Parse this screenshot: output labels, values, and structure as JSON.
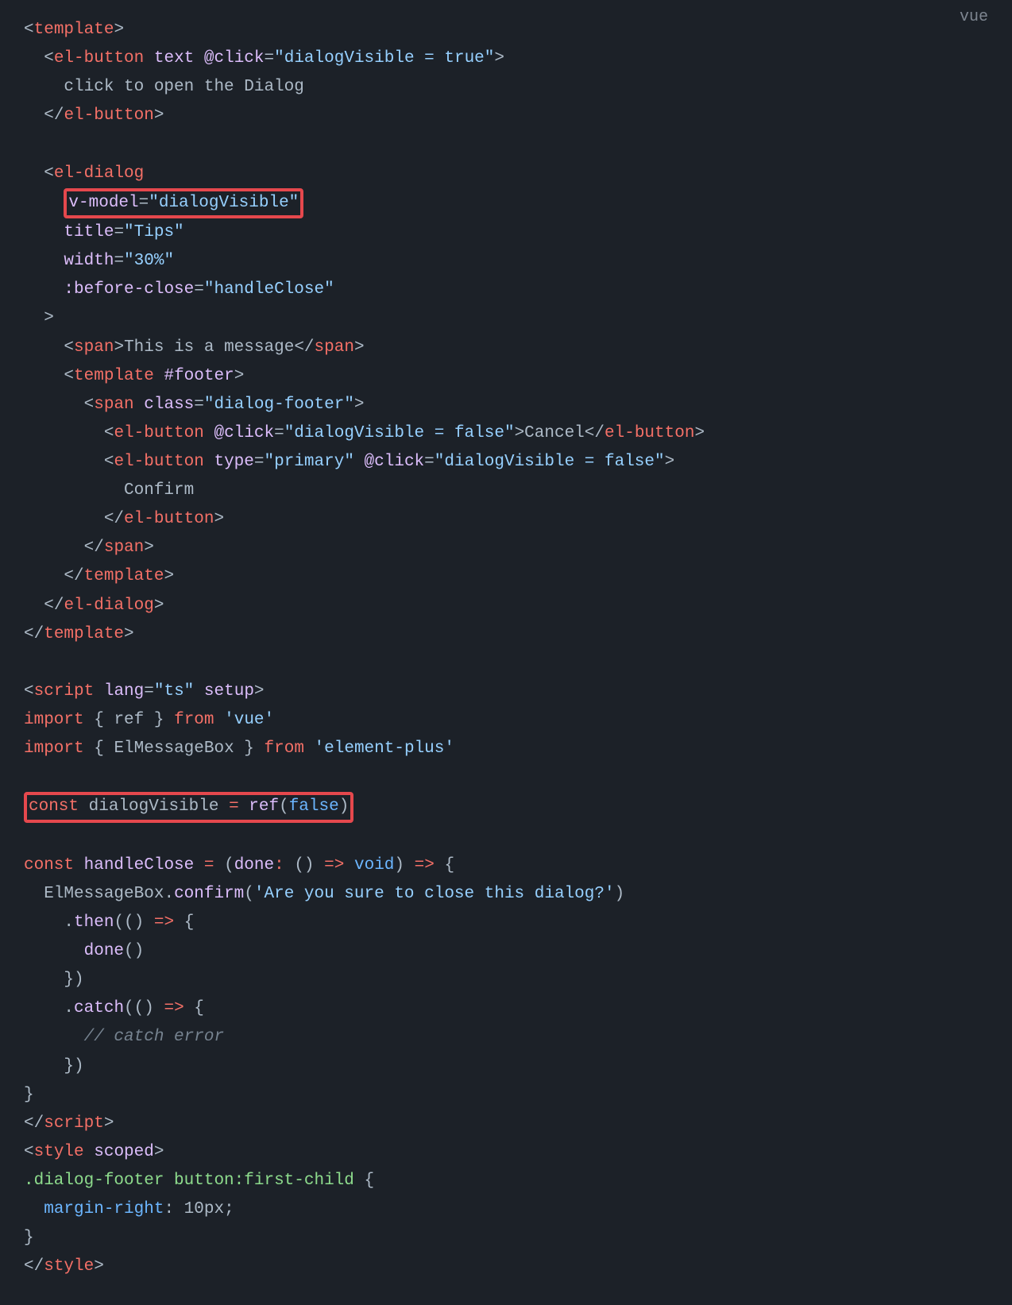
{
  "language": "vue",
  "highlights": [
    "v-model=\"dialogVisible\"",
    "const dialogVisible = ref(false)"
  ],
  "code": {
    "template": {
      "button": {
        "tag": "el-button",
        "attrs": [
          "text",
          "@click=\"dialogVisible = true\""
        ],
        "text": "click to open the Dialog"
      },
      "dialog": {
        "tag": "el-dialog",
        "attrs": [
          "v-model=\"dialogVisible\"",
          "title=\"Tips\"",
          "width=\"30%\"",
          ":before-close=\"handleClose\""
        ],
        "message": "This is a message",
        "footer": {
          "slot": "#footer",
          "span_class": "dialog-footer",
          "cancel": {
            "tag": "el-button",
            "attrs": [
              "@click=\"dialogVisible = false\""
            ],
            "text": "Cancel"
          },
          "confirm": {
            "tag": "el-button",
            "attrs": [
              "type=\"primary\"",
              "@click=\"dialogVisible = false\""
            ],
            "text": "Confirm"
          }
        }
      }
    },
    "script": {
      "lang": "ts",
      "setup": true,
      "imports": [
        {
          "names": [
            "ref"
          ],
          "from": "vue"
        },
        {
          "names": [
            "ElMessageBox"
          ],
          "from": "element-plus"
        }
      ],
      "const_dialogVisible": "ref(false)",
      "handleClose": {
        "sig": "(done: () => void) => {",
        "confirm_text": "Are you sure to close this dialog?",
        "then": "done()",
        "catch_comment": "// catch error"
      }
    },
    "style": {
      "scoped": true,
      "rule": ".dialog-footer button:first-child { margin-right: 10px; }"
    }
  }
}
